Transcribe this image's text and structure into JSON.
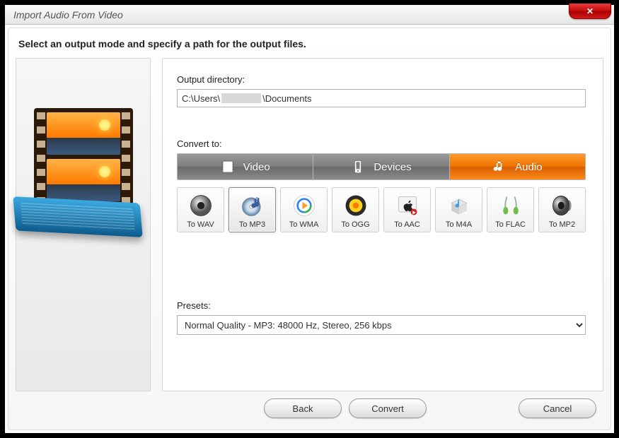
{
  "window": {
    "title": "Import Audio From Video"
  },
  "instruction": "Select an output mode and specify a path for the output files.",
  "output": {
    "label": "Output directory:",
    "path_prefix": "C:\\Users\\",
    "path_suffix": "\\Documents"
  },
  "convert": {
    "label": "Convert to:",
    "tabs": [
      {
        "id": "video",
        "label": "Video",
        "active": false
      },
      {
        "id": "devices",
        "label": "Devices",
        "active": false
      },
      {
        "id": "audio",
        "label": "Audio",
        "active": true
      }
    ],
    "formats": [
      {
        "id": "wav",
        "label": "To WAV"
      },
      {
        "id": "mp3",
        "label": "To MP3",
        "selected": true
      },
      {
        "id": "wma",
        "label": "To WMA"
      },
      {
        "id": "ogg",
        "label": "To OGG"
      },
      {
        "id": "aac",
        "label": "To AAC"
      },
      {
        "id": "m4a",
        "label": "To M4A"
      },
      {
        "id": "flac",
        "label": "To FLAC"
      },
      {
        "id": "mp2",
        "label": "To MP2"
      }
    ]
  },
  "presets": {
    "label": "Presets:",
    "selected": "Normal Quality - MP3: 48000 Hz, Stereo, 256 kbps"
  },
  "footer": {
    "back": "Back",
    "convert": "Convert",
    "cancel": "Cancel"
  },
  "colors": {
    "accent": "#f07400",
    "tabInactive": "#7d7d7d"
  }
}
